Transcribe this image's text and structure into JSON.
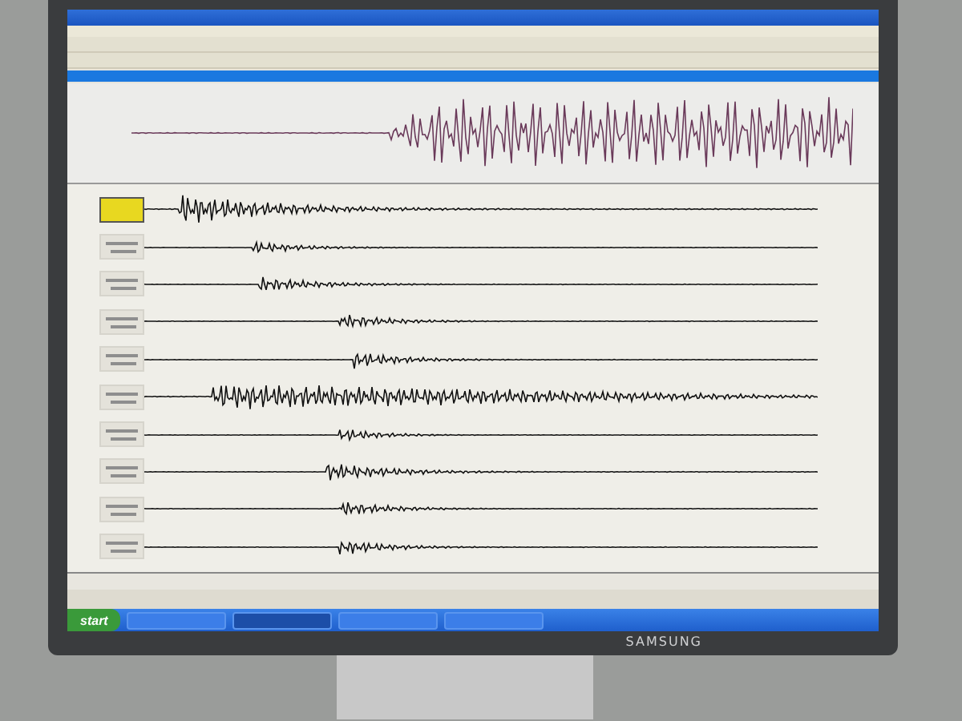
{
  "monitor": {
    "brand": "SAMSUNG"
  },
  "taskbar": {
    "start_label": "start",
    "buttons": [
      {
        "selected": false
      },
      {
        "selected": true
      },
      {
        "selected": false
      },
      {
        "selected": false
      }
    ]
  },
  "traces": [
    {
      "selected": true
    },
    {
      "selected": false
    },
    {
      "selected": false
    },
    {
      "selected": false
    },
    {
      "selected": false
    },
    {
      "selected": false
    },
    {
      "selected": false
    },
    {
      "selected": false
    },
    {
      "selected": false
    },
    {
      "selected": false
    }
  ]
}
